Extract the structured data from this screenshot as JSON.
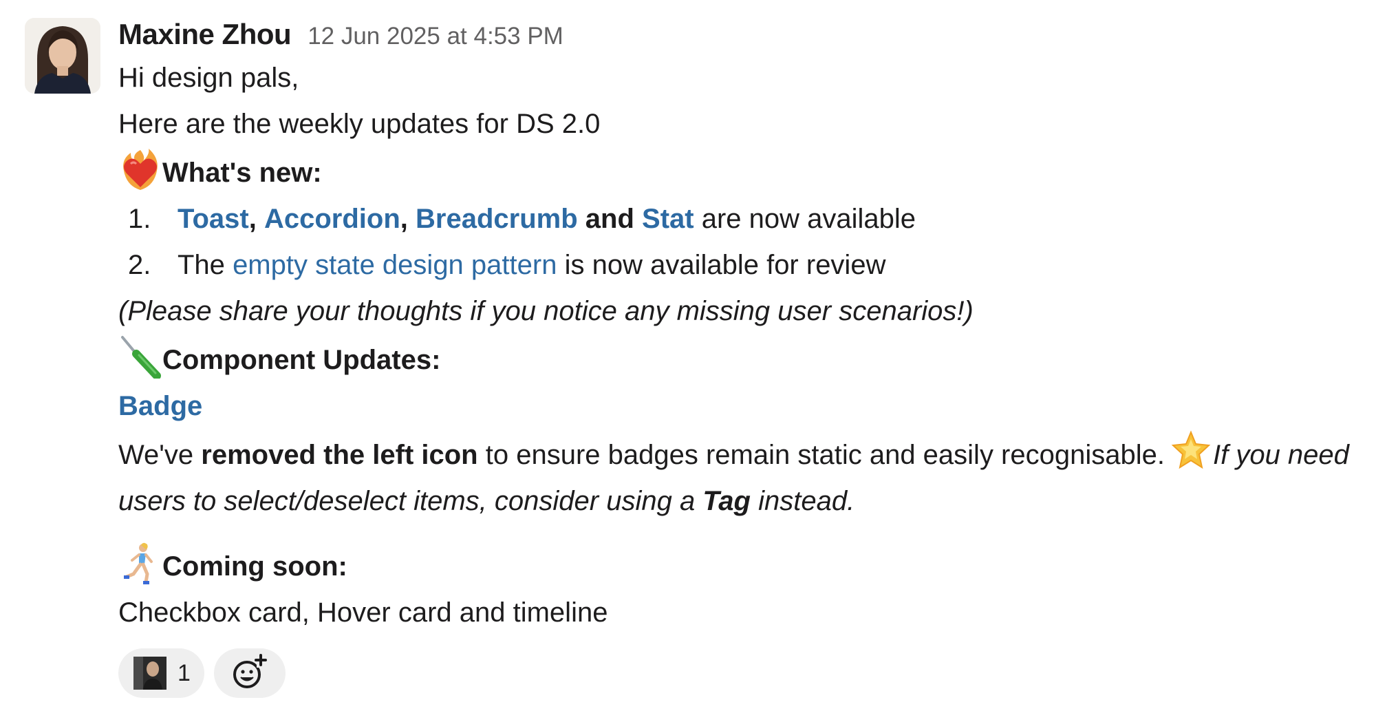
{
  "message": {
    "sender": "Maxine Zhou",
    "timestamp": "12 Jun 2025 at 4:53 PM",
    "greeting": "Hi design pals,",
    "intro": "Here are the weekly updates for DS 2.0",
    "whats_new": {
      "icon": "heart-on-fire-icon",
      "heading": "What's new:",
      "items": [
        {
          "number": "1.",
          "links": [
            "Toast",
            "Accordion",
            "Breadcrumb",
            "Stat"
          ],
          "separator": ",",
          "conjunction": "and",
          "suffix": "are now available"
        },
        {
          "number": "2.",
          "prefix": "The",
          "link": "empty state design pattern",
          "suffix": "is now available for review"
        }
      ],
      "note": "(Please share your thoughts if you notice any missing user scenarios!)"
    },
    "component_updates": {
      "icon": "screwdriver-icon",
      "heading": "Component Updates:",
      "component_link": "Badge",
      "text_start": "We've",
      "text_bold": "removed the left icon",
      "text_rest": "to ensure badges remain static and easily recognisable.",
      "star_icon": "glowing-star-icon",
      "italic_start": "If you need users to select/deselect items, consider using a",
      "italic_bold": "Tag",
      "italic_end": "instead."
    },
    "coming_soon": {
      "icon": "woman-running-icon",
      "heading": "Coming soon:",
      "text": "Checkbox card, Hover card and timeline"
    },
    "reactions": [
      {
        "type": "user-avatar",
        "count": "1"
      }
    ],
    "add_reaction_icon": "add-reaction-icon"
  },
  "colors": {
    "text": "#1d1c1d",
    "muted": "#616061",
    "link": "#2d6aa3",
    "reaction_bg": "#efefef"
  }
}
